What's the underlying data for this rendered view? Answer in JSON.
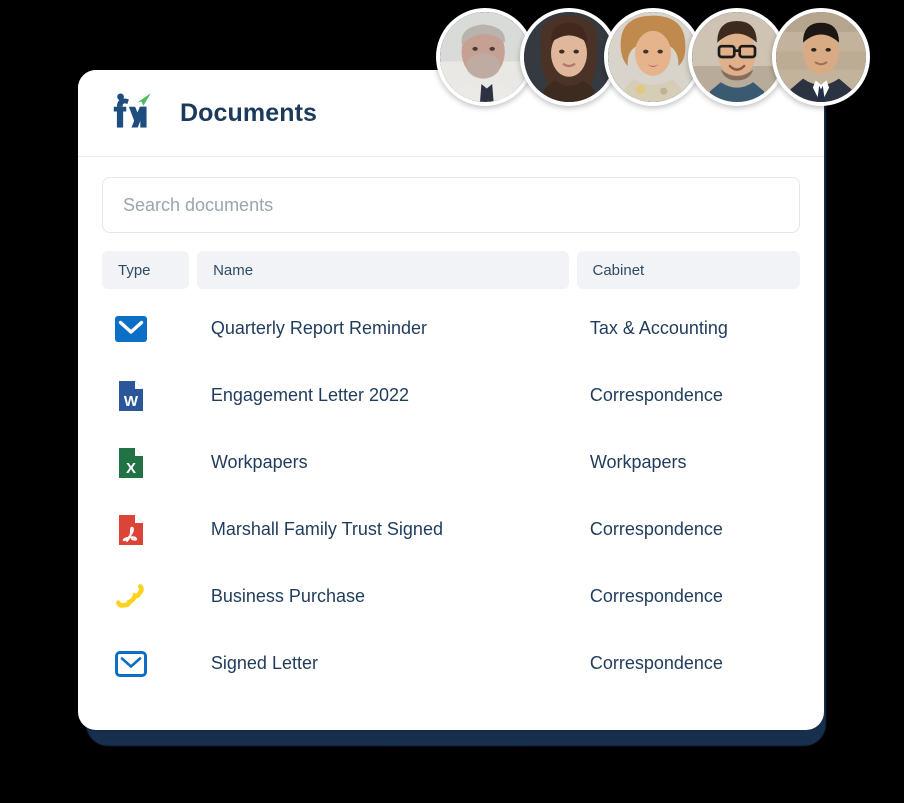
{
  "header": {
    "logo_icon": "fyi-logo-icon",
    "title": "Documents"
  },
  "search": {
    "placeholder": "Search documents",
    "value": ""
  },
  "table": {
    "columns": [
      {
        "key": "type",
        "label": "Type"
      },
      {
        "key": "name",
        "label": "Name"
      },
      {
        "key": "cabinet",
        "label": "Cabinet"
      }
    ],
    "rows": [
      {
        "icon": "envelope-filled-icon",
        "name": "Quarterly Report Reminder",
        "cabinet": "Tax & Accounting"
      },
      {
        "icon": "word-document-icon",
        "name": "Engagement Letter 2022",
        "cabinet": "Correspondence"
      },
      {
        "icon": "excel-document-icon",
        "name": "Workpapers",
        "cabinet": "Workpapers"
      },
      {
        "icon": "pdf-document-icon",
        "name": "Marshall Family Trust Signed",
        "cabinet": "Correspondence"
      },
      {
        "icon": "phone-icon",
        "name": "Business Purchase",
        "cabinet": "Correspondence"
      },
      {
        "icon": "envelope-outline-icon",
        "name": "Signed Letter",
        "cabinet": "Correspondence"
      }
    ]
  },
  "avatars": [
    {
      "name": "avatar-1"
    },
    {
      "name": "avatar-2"
    },
    {
      "name": "avatar-3"
    },
    {
      "name": "avatar-4"
    },
    {
      "name": "avatar-5"
    }
  ],
  "colors": {
    "background": "#000000",
    "card": "#ffffff",
    "card_shadow": "#18304f",
    "title": "#1b3a5c",
    "text": "#1f3c5c",
    "pill_bg": "#f1f3f6",
    "placeholder": "#9aa5b1",
    "logo_blue": "#1d4e7e",
    "logo_green": "#4cbb5f",
    "envelope_blue": "#0c6ec4",
    "word_blue": "#2b579a",
    "excel_green": "#217346",
    "pdf_red": "#db4437",
    "phone_yellow": "#ffd21e"
  }
}
